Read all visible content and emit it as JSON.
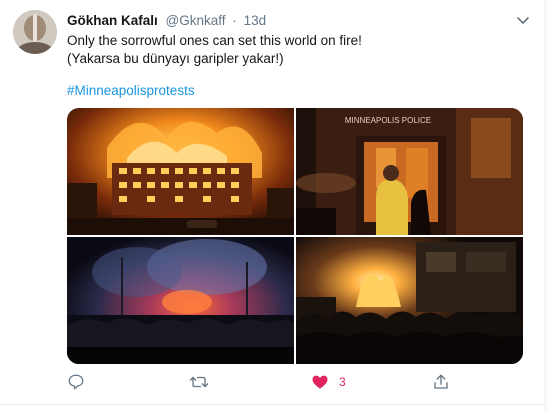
{
  "tweet": {
    "display_name": "Gökhan Kafalı",
    "handle": "@Gknkaff",
    "separator": "·",
    "time": "13d",
    "text_line1": "Only the sorrowful ones can set this world on fire!",
    "text_line2": "(Yakarsa bu dünyayı garipler yakar!)",
    "hashtag": "#Minneapolisprotests"
  },
  "media": {
    "photo2_sign": "MINNEAPOLIS POLICE"
  },
  "actions": {
    "reply_icon": "reply-bubble-icon",
    "retweet_icon": "retweet-icon",
    "like_icon": "heart-icon",
    "like_count": "3",
    "share_icon": "share-icon"
  },
  "colors": {
    "accent": "#1b95e0",
    "like": "#e0245e",
    "muted": "#657786"
  }
}
